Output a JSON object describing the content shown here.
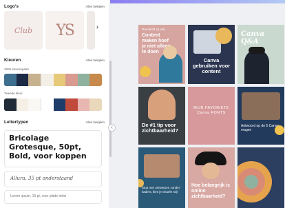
{
  "brand_panel": {
    "logos": {
      "title": "Logo's",
      "link": "Alles bekijken",
      "card1_text": "Club",
      "card2_text": "YS"
    },
    "colors": {
      "title": "Kleuren",
      "link": "Alles bekijken",
      "palette1_label": "2506 kleurenpalet",
      "palette1": [
        "#3f6f8f",
        "#1c2a43",
        "#c7b28f",
        "#f3eee6",
        "#e7c97a",
        "#d99a8f",
        "#8fb2a0",
        "#c7894c"
      ],
      "palette2_label": "Tweede kleur",
      "palette2": [
        "#222b38",
        "#f5efe6",
        "#faf8f4",
        "#ffffff",
        "#1f3d6b",
        "#c04a3c",
        "#e8b7b2",
        "#e9d8bb"
      ]
    },
    "fonts": {
      "title": "Lettertypen",
      "link": "Alles bekijken",
      "heading_sample": "Bricolage Grotesque, 50pt, Bold, voor koppen",
      "script_sample": "Allura, 35 pt onderstaand",
      "body_sample": "Lorem ipsum, 16 pt, voor platte tekst"
    }
  },
  "canvas": {
    "tiles": [
      {
        "text": "Content maken hoef je niet alleen te doen",
        "small": "Dat dacht zij ook..."
      },
      {
        "text": "Canva gebruiken voor content"
      },
      {
        "text": "Canva Q&A"
      },
      {
        "text": "De #1 tip voor zichtbaarheid?"
      },
      {
        "text": "MIJN FAVORIETE Canva FONTS"
      },
      {
        "text": "Antwoord op de 5 Canva vragen"
      },
      {
        "text": "Stop met ontwerpen zonder kaders, kies je visuele stijl"
      },
      {
        "text": "Hoe belangrijk is online zichtbaarheid?"
      },
      {
        "text": ""
      }
    ]
  }
}
